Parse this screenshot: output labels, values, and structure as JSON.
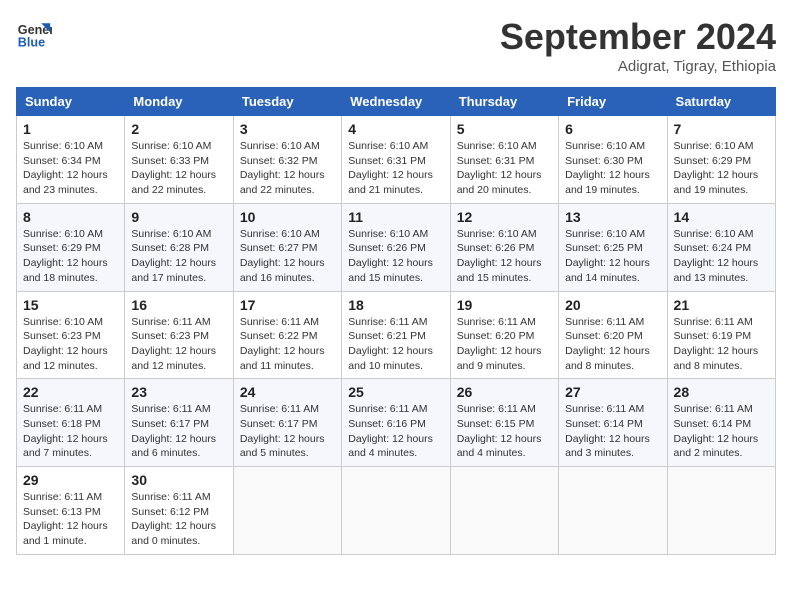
{
  "header": {
    "logo_line1": "General",
    "logo_line2": "Blue",
    "month": "September 2024",
    "location": "Adigrat, Tigray, Ethiopia"
  },
  "weekdays": [
    "Sunday",
    "Monday",
    "Tuesday",
    "Wednesday",
    "Thursday",
    "Friday",
    "Saturday"
  ],
  "weeks": [
    [
      {
        "day": "1",
        "sunrise": "6:10 AM",
        "sunset": "6:34 PM",
        "daylight": "12 hours and 23 minutes."
      },
      {
        "day": "2",
        "sunrise": "6:10 AM",
        "sunset": "6:33 PM",
        "daylight": "12 hours and 22 minutes."
      },
      {
        "day": "3",
        "sunrise": "6:10 AM",
        "sunset": "6:32 PM",
        "daylight": "12 hours and 22 minutes."
      },
      {
        "day": "4",
        "sunrise": "6:10 AM",
        "sunset": "6:31 PM",
        "daylight": "12 hours and 21 minutes."
      },
      {
        "day": "5",
        "sunrise": "6:10 AM",
        "sunset": "6:31 PM",
        "daylight": "12 hours and 20 minutes."
      },
      {
        "day": "6",
        "sunrise": "6:10 AM",
        "sunset": "6:30 PM",
        "daylight": "12 hours and 19 minutes."
      },
      {
        "day": "7",
        "sunrise": "6:10 AM",
        "sunset": "6:29 PM",
        "daylight": "12 hours and 19 minutes."
      }
    ],
    [
      {
        "day": "8",
        "sunrise": "6:10 AM",
        "sunset": "6:29 PM",
        "daylight": "12 hours and 18 minutes."
      },
      {
        "day": "9",
        "sunrise": "6:10 AM",
        "sunset": "6:28 PM",
        "daylight": "12 hours and 17 minutes."
      },
      {
        "day": "10",
        "sunrise": "6:10 AM",
        "sunset": "6:27 PM",
        "daylight": "12 hours and 16 minutes."
      },
      {
        "day": "11",
        "sunrise": "6:10 AM",
        "sunset": "6:26 PM",
        "daylight": "12 hours and 15 minutes."
      },
      {
        "day": "12",
        "sunrise": "6:10 AM",
        "sunset": "6:26 PM",
        "daylight": "12 hours and 15 minutes."
      },
      {
        "day": "13",
        "sunrise": "6:10 AM",
        "sunset": "6:25 PM",
        "daylight": "12 hours and 14 minutes."
      },
      {
        "day": "14",
        "sunrise": "6:10 AM",
        "sunset": "6:24 PM",
        "daylight": "12 hours and 13 minutes."
      }
    ],
    [
      {
        "day": "15",
        "sunrise": "6:10 AM",
        "sunset": "6:23 PM",
        "daylight": "12 hours and 12 minutes."
      },
      {
        "day": "16",
        "sunrise": "6:11 AM",
        "sunset": "6:23 PM",
        "daylight": "12 hours and 12 minutes."
      },
      {
        "day": "17",
        "sunrise": "6:11 AM",
        "sunset": "6:22 PM",
        "daylight": "12 hours and 11 minutes."
      },
      {
        "day": "18",
        "sunrise": "6:11 AM",
        "sunset": "6:21 PM",
        "daylight": "12 hours and 10 minutes."
      },
      {
        "day": "19",
        "sunrise": "6:11 AM",
        "sunset": "6:20 PM",
        "daylight": "12 hours and 9 minutes."
      },
      {
        "day": "20",
        "sunrise": "6:11 AM",
        "sunset": "6:20 PM",
        "daylight": "12 hours and 8 minutes."
      },
      {
        "day": "21",
        "sunrise": "6:11 AM",
        "sunset": "6:19 PM",
        "daylight": "12 hours and 8 minutes."
      }
    ],
    [
      {
        "day": "22",
        "sunrise": "6:11 AM",
        "sunset": "6:18 PM",
        "daylight": "12 hours and 7 minutes."
      },
      {
        "day": "23",
        "sunrise": "6:11 AM",
        "sunset": "6:17 PM",
        "daylight": "12 hours and 6 minutes."
      },
      {
        "day": "24",
        "sunrise": "6:11 AM",
        "sunset": "6:17 PM",
        "daylight": "12 hours and 5 minutes."
      },
      {
        "day": "25",
        "sunrise": "6:11 AM",
        "sunset": "6:16 PM",
        "daylight": "12 hours and 4 minutes."
      },
      {
        "day": "26",
        "sunrise": "6:11 AM",
        "sunset": "6:15 PM",
        "daylight": "12 hours and 4 minutes."
      },
      {
        "day": "27",
        "sunrise": "6:11 AM",
        "sunset": "6:14 PM",
        "daylight": "12 hours and 3 minutes."
      },
      {
        "day": "28",
        "sunrise": "6:11 AM",
        "sunset": "6:14 PM",
        "daylight": "12 hours and 2 minutes."
      }
    ],
    [
      {
        "day": "29",
        "sunrise": "6:11 AM",
        "sunset": "6:13 PM",
        "daylight": "12 hours and 1 minute."
      },
      {
        "day": "30",
        "sunrise": "6:11 AM",
        "sunset": "6:12 PM",
        "daylight": "12 hours and 0 minutes."
      },
      null,
      null,
      null,
      null,
      null
    ]
  ],
  "labels": {
    "sunrise": "Sunrise:",
    "sunset": "Sunset:",
    "daylight": "Daylight:"
  }
}
